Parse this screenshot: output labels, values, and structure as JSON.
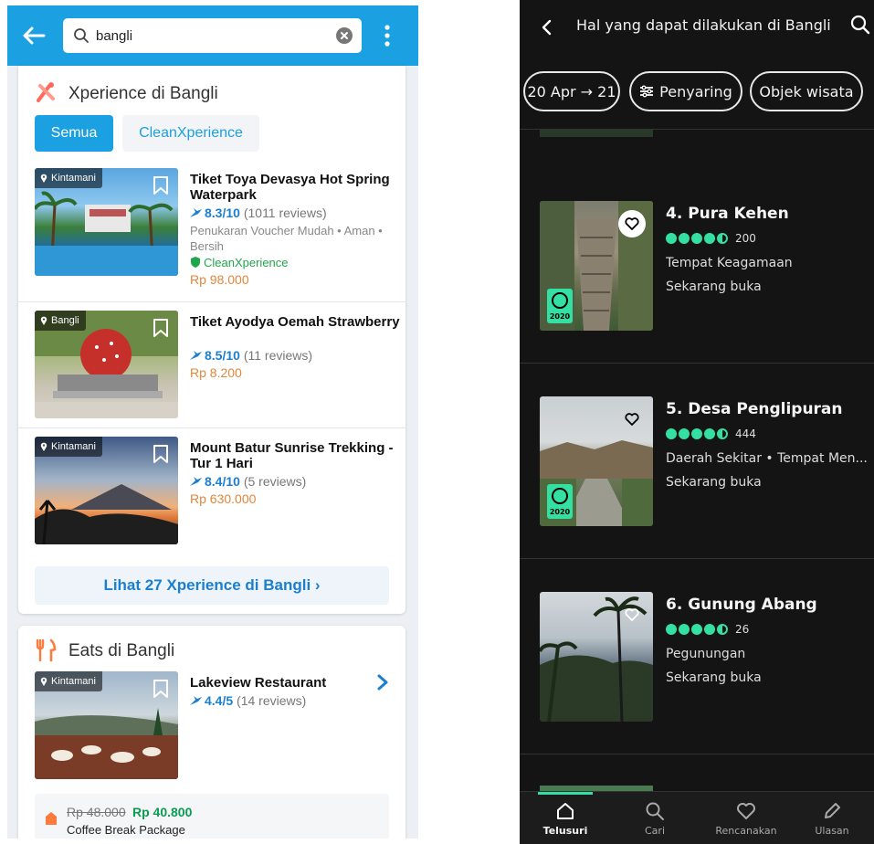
{
  "left": {
    "search": {
      "value": "bangli"
    },
    "xperience": {
      "title": "Xperience di Bangli",
      "chips": [
        "Semua",
        "CleanXperience"
      ],
      "items": [
        {
          "location": "Kintamani",
          "title": "Tiket Toya Devasya Hot Spring Waterpark",
          "rating": "8.3/10",
          "reviews": "(1011 reviews)",
          "subtitle": "Penukaran Voucher Mudah • Aman • Bersih",
          "clean": "CleanXperience",
          "price": "Rp 98.000"
        },
        {
          "location": "Bangli",
          "title": "Tiket Ayodya Oemah Strawberry",
          "rating": "8.5/10",
          "reviews": "(11 reviews)",
          "price": "Rp 8.200"
        },
        {
          "location": "Kintamani",
          "title": "Mount Batur Sunrise Trekking - Tur 1 Hari",
          "rating": "8.4/10",
          "reviews": "(5 reviews)",
          "price": "Rp 630.000"
        }
      ],
      "see_all": "Lihat 27 Xperience di Bangli ›"
    },
    "eats": {
      "title": "Eats di Bangli",
      "item": {
        "location": "Kintamani",
        "title": "Lakeview Restaurant",
        "rating": "4.4/5",
        "reviews": "(14 reviews)"
      },
      "promo": {
        "old_price": "Rp 48.000",
        "new_price": "Rp 40.800",
        "name": "Coffee Break Package"
      }
    },
    "colors": {
      "primary": "#1ba0e2",
      "price": "#e3863a",
      "clean": "#1fa64a",
      "rating": "#1b7fd0"
    }
  },
  "right": {
    "title": "Hal yang dapat dilakukan di Bangli",
    "filters": {
      "date": "20 Apr → 21",
      "filter": "Penyaring",
      "type": "Objek wisata"
    },
    "items": [
      {
        "name": "4. Pura Kehen",
        "reviews": "200",
        "category": "Tempat Keagamaan",
        "status": "Sekarang buka",
        "award": "2020"
      },
      {
        "name": "5. Desa Penglipuran",
        "reviews": "444",
        "category": "Daerah Sekitar • Tempat Men...",
        "status": "Sekarang buka",
        "award": "2020"
      },
      {
        "name": "6. Gunung Abang",
        "reviews": "26",
        "category": "Pegunungan",
        "status": "Sekarang buka"
      }
    ],
    "tabs": [
      "Telusuri",
      "Cari",
      "Rencanakan",
      "Ulasan"
    ],
    "colors": {
      "accent": "#34e0a1",
      "background": "#141414"
    }
  }
}
